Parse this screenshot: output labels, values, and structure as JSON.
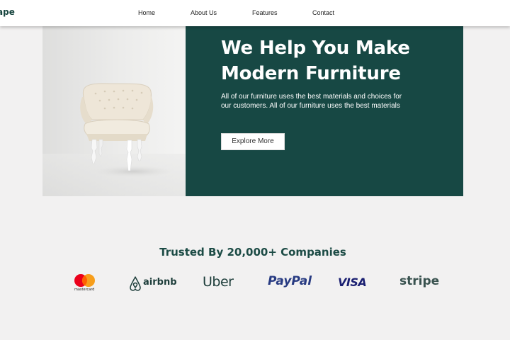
{
  "brand": {
    "logo_text": "ape"
  },
  "nav": {
    "items": [
      {
        "label": "Home"
      },
      {
        "label": "About Us"
      },
      {
        "label": "Features"
      },
      {
        "label": "Contact"
      }
    ]
  },
  "hero": {
    "title": "We Help You Make Modern Furniture",
    "description": "All of our furniture uses the best materials and choices for our customers. All of our furniture uses the best materials",
    "button_label": "Explore More",
    "panel_color": "#174844",
    "image_subject": "white tufted armchair"
  },
  "trusted": {
    "title": "Trusted By 20,000+ Companies",
    "logos": [
      {
        "name": "mastercard",
        "text": "mastercard",
        "icon": "mastercard-logo"
      },
      {
        "name": "airbnb",
        "text": "airbnb",
        "icon": "airbnb-logo"
      },
      {
        "name": "uber",
        "text": "Uber",
        "icon": "uber-logo"
      },
      {
        "name": "paypal",
        "text": "PayPal",
        "icon": "paypal-logo"
      },
      {
        "name": "visa",
        "text": "VISA",
        "icon": "visa-logo"
      },
      {
        "name": "stripe",
        "text": "stripe",
        "icon": "stripe-logo"
      }
    ]
  },
  "colors": {
    "accent": "#174844",
    "background": "#f2f1f1",
    "heading": "#1c4b45"
  }
}
